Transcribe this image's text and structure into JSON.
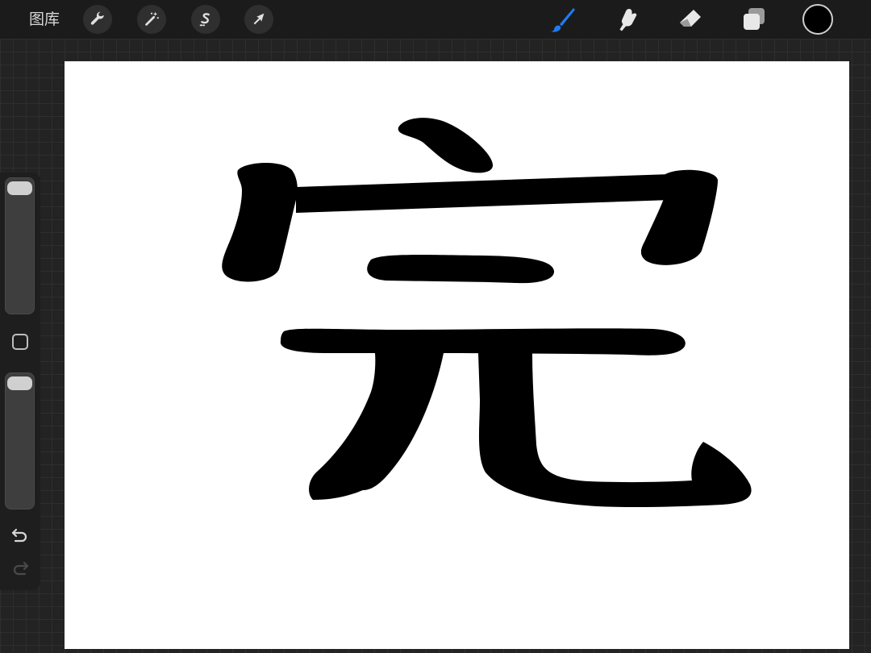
{
  "toolbar": {
    "gallery_label": "图库",
    "left_tools": [
      {
        "name": "actions",
        "icon": "wrench-icon"
      },
      {
        "name": "adjustments",
        "icon": "magic-wand-icon"
      },
      {
        "name": "selection",
        "icon": "selection-s-icon"
      },
      {
        "name": "transform",
        "icon": "arrow-cursor-icon"
      }
    ],
    "right_tools": [
      {
        "name": "brush",
        "icon": "paintbrush-icon",
        "active": true
      },
      {
        "name": "smudge",
        "icon": "smudge-finger-icon",
        "active": false
      },
      {
        "name": "eraser",
        "icon": "eraser-icon",
        "active": false
      },
      {
        "name": "layers",
        "icon": "layers-icon",
        "active": false
      }
    ],
    "current_color": "#000000",
    "active_tool_color": "#1e7cf2"
  },
  "canvas": {
    "background": "#ffffff",
    "drawing": "完",
    "ink_color": "#000000"
  },
  "sidebar": {
    "brush_size_level": 0,
    "opacity_level": 0,
    "modify_icon": "square-modify-icon",
    "undo_icon": "undo-arrow-icon",
    "redo_icon": "redo-arrow-icon",
    "redo_enabled": false
  }
}
